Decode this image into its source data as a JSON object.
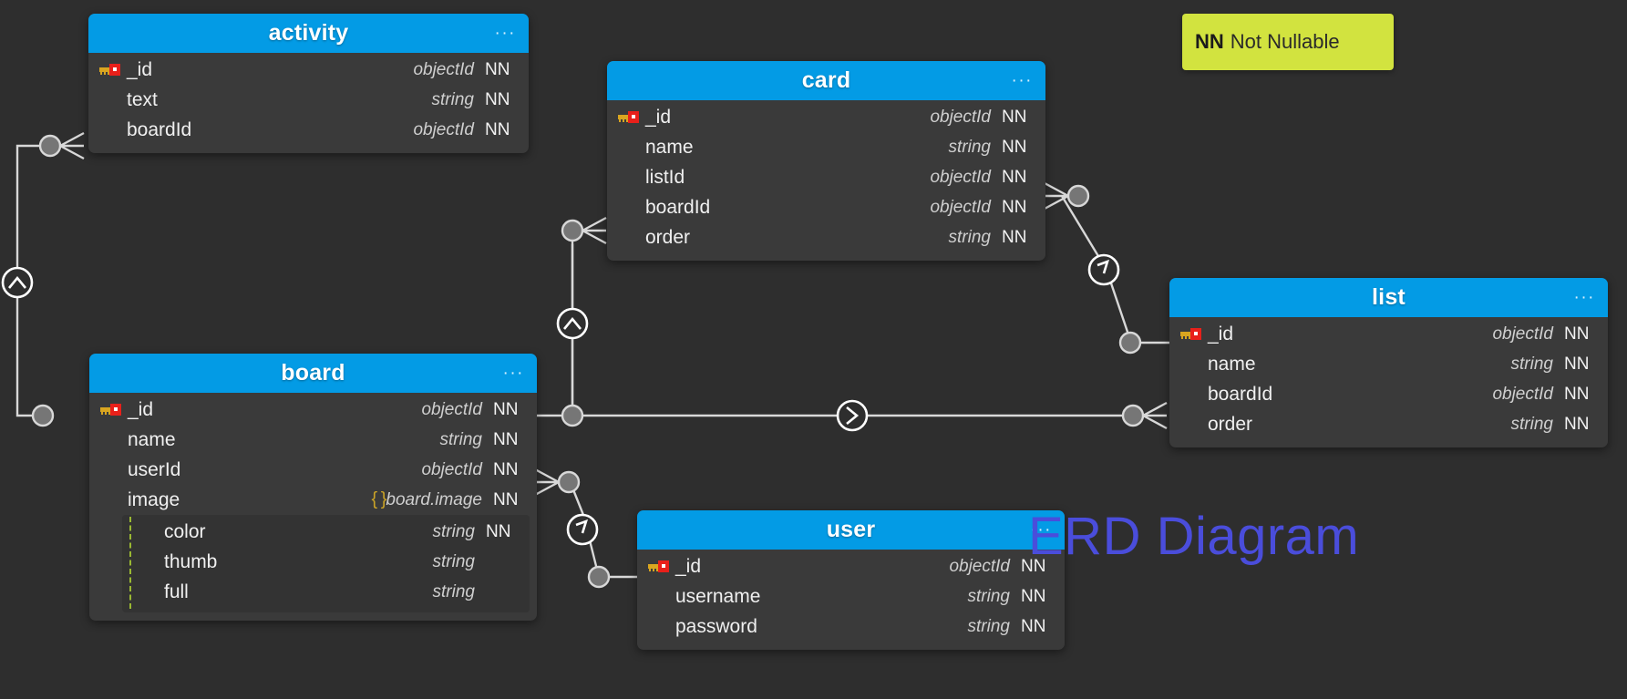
{
  "caption": "ERD Diagram",
  "caption_color": "#4a4ddb",
  "legend": {
    "abbr": "NN",
    "text": "Not Nullable",
    "bg_color": "#d2e33f"
  },
  "theme": {
    "canvas_bg": "#2e2e2e",
    "table_bg": "#3a3a3a",
    "header_bg": "#039be5",
    "nested_bg": "#333333",
    "nested_guide": "#9ab832",
    "edge_color": "#d8d8d8",
    "key_gold": "#d9a520",
    "key_red": "#e8201a",
    "brace_gold": "#c9a227"
  },
  "menu_glyph": "···",
  "tables": [
    {
      "id": "activity",
      "name": "activity",
      "menu": "···",
      "fields": [
        {
          "pk": true,
          "name": "_id",
          "type": "objectId",
          "nn": "NN"
        },
        {
          "pk": false,
          "name": "text",
          "type": "string",
          "nn": "NN"
        },
        {
          "pk": false,
          "name": "boardId",
          "type": "objectId",
          "nn": "NN"
        }
      ]
    },
    {
      "id": "card",
      "name": "card",
      "menu": "···",
      "fields": [
        {
          "pk": true,
          "name": "_id",
          "type": "objectId",
          "nn": "NN"
        },
        {
          "pk": false,
          "name": "name",
          "type": "string",
          "nn": "NN"
        },
        {
          "pk": false,
          "name": "listId",
          "type": "objectId",
          "nn": "NN"
        },
        {
          "pk": false,
          "name": "boardId",
          "type": "objectId",
          "nn": "NN"
        },
        {
          "pk": false,
          "name": "order",
          "type": "string",
          "nn": "NN"
        }
      ]
    },
    {
      "id": "board",
      "name": "board",
      "menu": "···",
      "fields": [
        {
          "pk": true,
          "name": "_id",
          "type": "objectId",
          "nn": "NN"
        },
        {
          "pk": false,
          "name": "name",
          "type": "string",
          "nn": "NN"
        },
        {
          "pk": false,
          "name": "userId",
          "type": "objectId",
          "nn": "NN"
        },
        {
          "pk": false,
          "name": "image",
          "type": "board.image",
          "nn": "NN",
          "braces": "{ }"
        }
      ],
      "nested_fields": [
        {
          "pk": false,
          "name": "color",
          "type": "string",
          "nn": "NN"
        },
        {
          "pk": false,
          "name": "thumb",
          "type": "string",
          "nn": ""
        },
        {
          "pk": false,
          "name": "full",
          "type": "string",
          "nn": ""
        }
      ]
    },
    {
      "id": "list",
      "name": "list",
      "menu": "···",
      "fields": [
        {
          "pk": true,
          "name": "_id",
          "type": "objectId",
          "nn": "NN"
        },
        {
          "pk": false,
          "name": "name",
          "type": "string",
          "nn": "NN"
        },
        {
          "pk": false,
          "name": "boardId",
          "type": "objectId",
          "nn": "NN"
        },
        {
          "pk": false,
          "name": "order",
          "type": "string",
          "nn": "NN"
        }
      ]
    },
    {
      "id": "user",
      "name": "user",
      "menu": "···",
      "fields": [
        {
          "pk": true,
          "name": "_id",
          "type": "objectId",
          "nn": "NN"
        },
        {
          "pk": false,
          "name": "username",
          "type": "string",
          "nn": "NN"
        },
        {
          "pk": false,
          "name": "password",
          "type": "string",
          "nn": "NN"
        }
      ]
    }
  ],
  "relationships": [
    {
      "from": "board",
      "from_field": "_id",
      "to": "activity",
      "to_field": "boardId",
      "cardinality": "one-to-many"
    },
    {
      "from": "board",
      "from_field": "_id",
      "to": "card",
      "to_field": "boardId",
      "cardinality": "one-to-many"
    },
    {
      "from": "board",
      "from_field": "_id",
      "to": "list",
      "to_field": "boardId",
      "cardinality": "one-to-many"
    },
    {
      "from": "list",
      "from_field": "_id",
      "to": "card",
      "to_field": "listId",
      "cardinality": "one-to-many"
    },
    {
      "from": "user",
      "from_field": "_id",
      "to": "board",
      "to_field": "userId",
      "cardinality": "one-to-many"
    }
  ]
}
